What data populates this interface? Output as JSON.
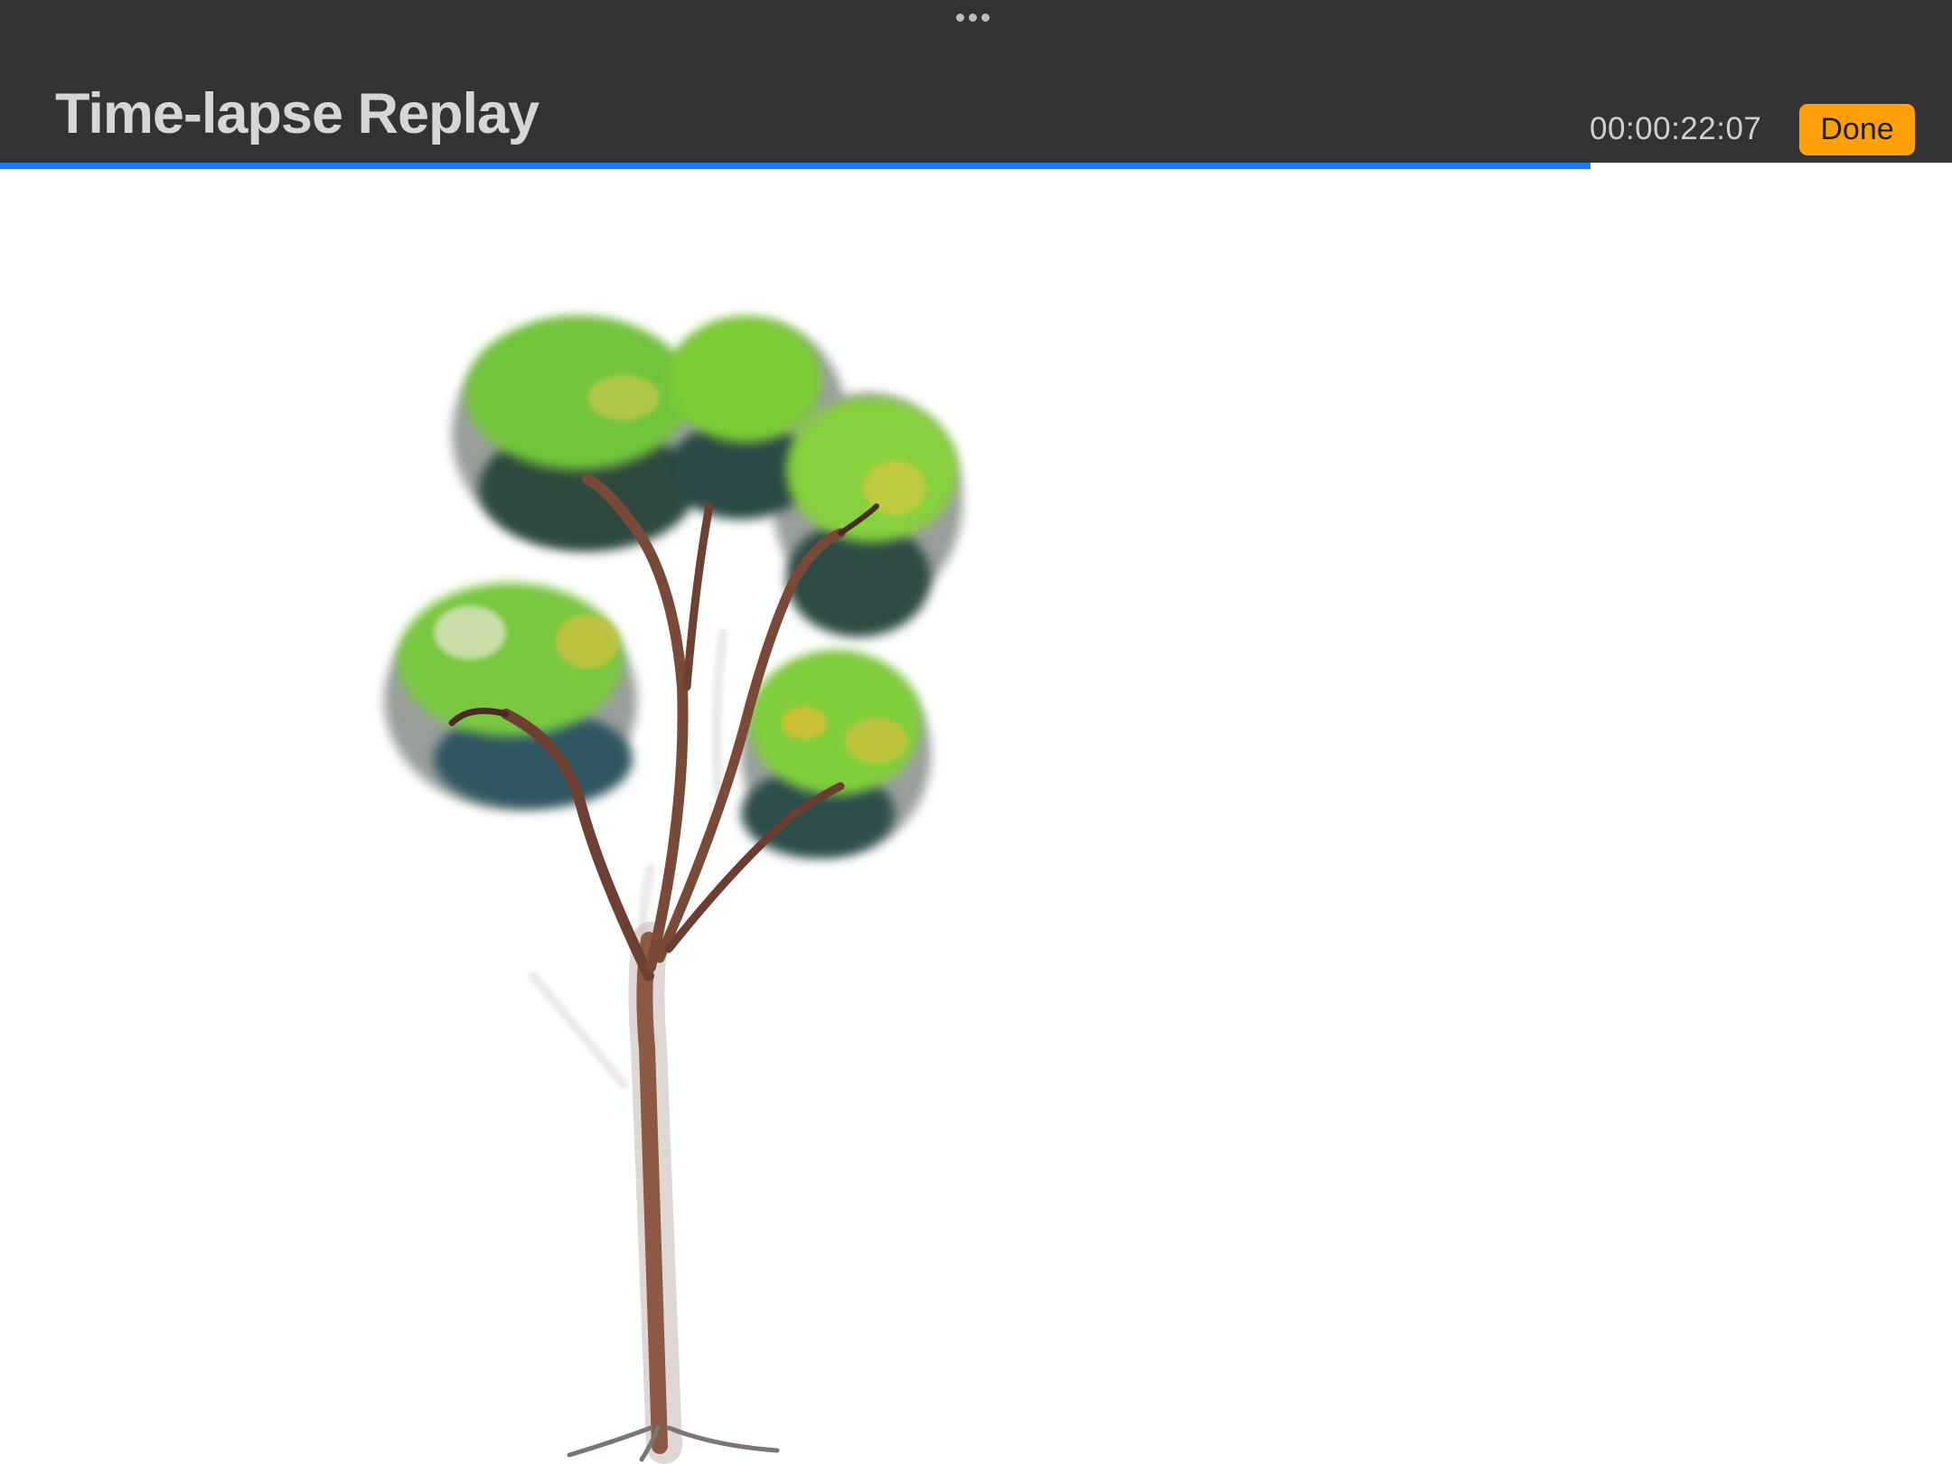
{
  "header": {
    "title": "Time-lapse Replay",
    "timecode": "00:00:22:07",
    "done_label": "Done"
  },
  "playback": {
    "progress_fraction": 0.815
  },
  "colors": {
    "topbar": "#333333",
    "accent_progress": "#1a7cf5",
    "done_button": "#ff9f0a",
    "canvas": "#ffffff"
  },
  "icons": {
    "grabber": "more-dots-icon"
  },
  "canvas": {
    "artwork": "tree-painting"
  }
}
